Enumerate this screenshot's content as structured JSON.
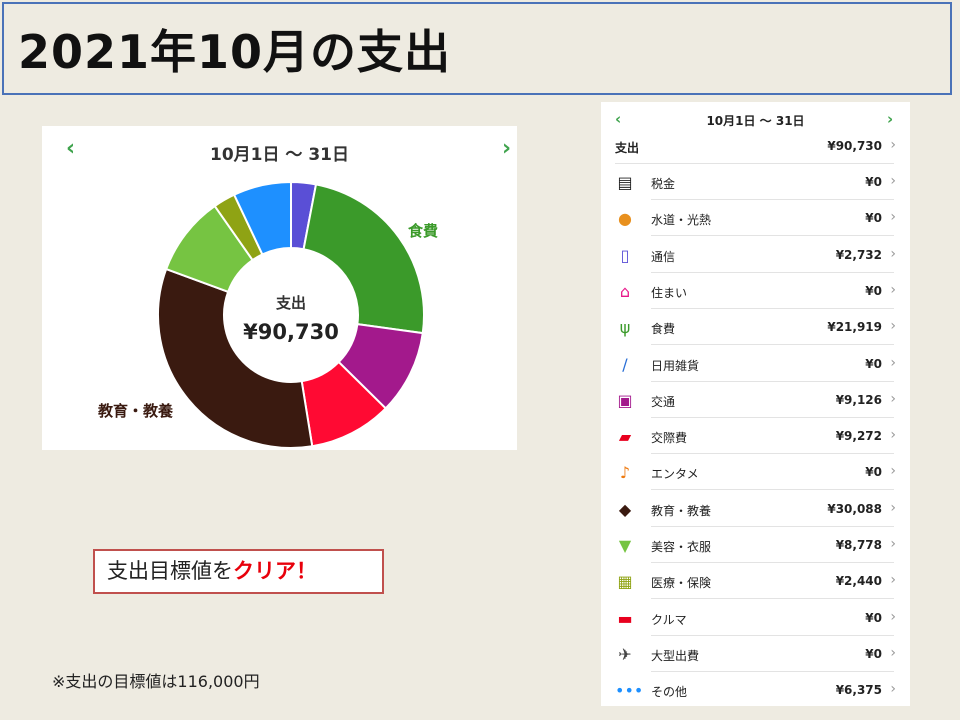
{
  "title": "2021年10月の支出",
  "chart_data": {
    "type": "pie",
    "range_label": "10月1日 〜 31日",
    "center_label": "支出",
    "center_value": "¥90,730",
    "total": 90730,
    "slices": [
      {
        "name": "通信",
        "value": 2732,
        "color": "#5a4fd6"
      },
      {
        "name": "食費",
        "value": 21919,
        "color": "#3b9a2a",
        "label": "食費"
      },
      {
        "name": "交際費",
        "value": 9272,
        "color": "#a3198c"
      },
      {
        "name": "交通",
        "value": 9126,
        "color": "#ff0a33"
      },
      {
        "name": "教育・教養",
        "value": 30088,
        "color": "#3a1a10",
        "label": "教育・教養"
      },
      {
        "name": "美容・衣服",
        "value": 8778,
        "color": "#76c442"
      },
      {
        "name": "医療・保険",
        "value": 2440,
        "color": "#8fa314"
      },
      {
        "name": "その他",
        "value": 6375,
        "color": "#1e90ff"
      }
    ]
  },
  "chart_nav": {
    "prev": "‹",
    "next": "›"
  },
  "goal": {
    "text": "支出目標値を",
    "emph": "クリア！"
  },
  "note": "※支出の目標値は116,000円",
  "list": {
    "range_label": "10月1日 〜 31日",
    "prev": "‹",
    "next": "›",
    "total_label": "支出",
    "total_amount": "¥90,730",
    "chevron": "›",
    "items": [
      {
        "name": "税金",
        "amount": "¥0",
        "icon": "receipt-icon",
        "glyph": "▤",
        "color": "#222222"
      },
      {
        "name": "水道・光熱",
        "amount": "¥0",
        "icon": "lightbulb-icon",
        "glyph": "●",
        "color": "#e8901e"
      },
      {
        "name": "通信",
        "amount": "¥2,732",
        "icon": "phone-icon",
        "glyph": "▯",
        "color": "#5a4fd6"
      },
      {
        "name": "住まい",
        "amount": "¥0",
        "icon": "house-icon",
        "glyph": "⌂",
        "color": "#e8178a"
      },
      {
        "name": "食費",
        "amount": "¥21,919",
        "icon": "fork-knife-icon",
        "glyph": "ψ",
        "color": "#3b9a2a"
      },
      {
        "name": "日用雑貨",
        "amount": "¥0",
        "icon": "toothbrush-icon",
        "glyph": "/",
        "color": "#2a6fd6"
      },
      {
        "name": "交通",
        "amount": "¥9,126",
        "icon": "train-icon",
        "glyph": "▣",
        "color": "#a3198c"
      },
      {
        "name": "交際費",
        "amount": "¥9,272",
        "icon": "chat-icon",
        "glyph": "▰",
        "color": "#e8001e"
      },
      {
        "name": "エンタメ",
        "amount": "¥0",
        "icon": "music-note-icon",
        "glyph": "♪",
        "color": "#ee7a10"
      },
      {
        "name": "教育・教養",
        "amount": "¥30,088",
        "icon": "graduation-cap-icon",
        "glyph": "◆",
        "color": "#3a1a10"
      },
      {
        "name": "美容・衣服",
        "amount": "¥8,778",
        "icon": "shirt-icon",
        "glyph": "▼",
        "color": "#76c442"
      },
      {
        "name": "医療・保険",
        "amount": "¥2,440",
        "icon": "hospital-icon",
        "glyph": "▦",
        "color": "#8fa314"
      },
      {
        "name": "クルマ",
        "amount": "¥0",
        "icon": "car-icon",
        "glyph": "▬",
        "color": "#e8001e"
      },
      {
        "name": "大型出費",
        "amount": "¥0",
        "icon": "airplane-icon",
        "glyph": "✈",
        "color": "#444444"
      },
      {
        "name": "その他",
        "amount": "¥6,375",
        "icon": "more-dots-icon",
        "glyph": "•••",
        "color": "#1e90ff"
      }
    ]
  }
}
